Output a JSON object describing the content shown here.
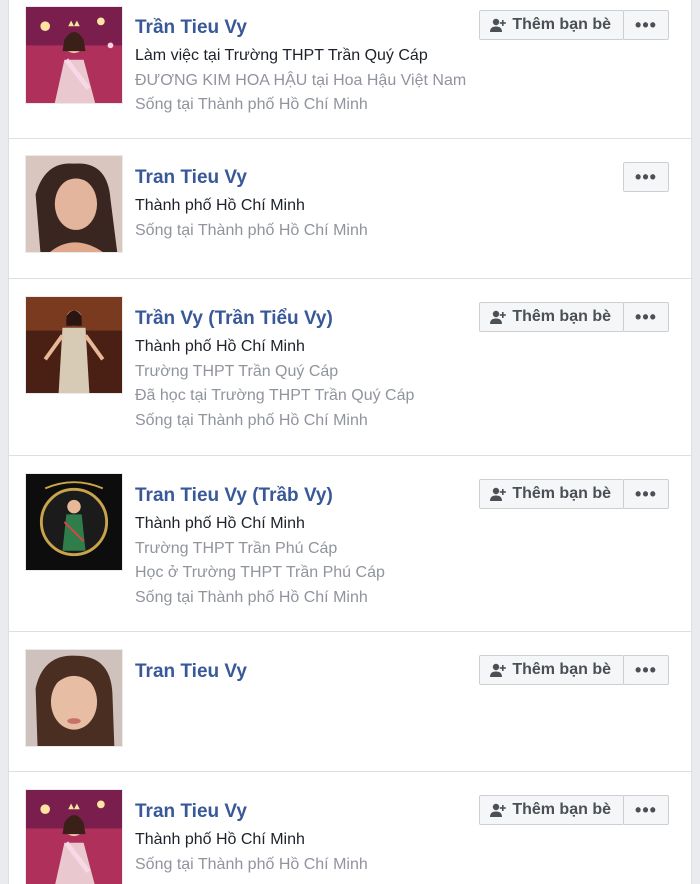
{
  "add_friend_label": "Thêm bạn bè",
  "more_label": "•••",
  "results": [
    {
      "name": "Trần Tieu Vy",
      "lines": [
        {
          "text": "Làm việc tại Trường THPT Trần Quý Cáp",
          "style": "dark"
        },
        {
          "text": "ĐƯƠNG KIM HOA HẬU tại Hoa Hậu Việt Nam",
          "style": "muted"
        },
        {
          "text": "Sống tại Thành phố Hồ Chí Minh",
          "style": "muted"
        }
      ],
      "has_add_friend": true
    },
    {
      "name": "Tran Tieu Vy",
      "lines": [
        {
          "text": "Thành phố Hồ Chí Minh",
          "style": "dark"
        },
        {
          "text": "Sống tại Thành phố Hồ Chí Minh",
          "style": "muted"
        }
      ],
      "has_add_friend": false
    },
    {
      "name": "Trần Vy (Trần Tiểu Vy)",
      "lines": [
        {
          "text": "Thành phố Hồ Chí Minh",
          "style": "dark"
        },
        {
          "text": "Trường THPT Trần Quý Cáp",
          "style": "muted"
        },
        {
          "text": "Đã học tại Trường THPT Trần Quý Cáp",
          "style": "muted"
        },
        {
          "text": "Sống tại Thành phố Hồ Chí Minh",
          "style": "muted"
        }
      ],
      "has_add_friend": true
    },
    {
      "name": "Tran Tieu Vy (Trầb Vy)",
      "lines": [
        {
          "text": "Thành phố Hồ Chí Minh",
          "style": "dark"
        },
        {
          "text": "Trường THPT Trần Phú Cáp",
          "style": "muted"
        },
        {
          "text": "Học ở Trường THPT Trần Phú Cáp",
          "style": "muted"
        },
        {
          "text": "Sống tại Thành phố Hồ Chí Minh",
          "style": "muted"
        }
      ],
      "has_add_friend": true
    },
    {
      "name": "Tran Tieu Vy",
      "lines": [],
      "has_add_friend": true
    },
    {
      "name": "Tran Tieu Vy",
      "lines": [
        {
          "text": "Thành phố Hồ Chí Minh",
          "style": "dark"
        },
        {
          "text": "Sống tại Thành phố Hồ Chí Minh",
          "style": "muted"
        }
      ],
      "has_add_friend": true
    }
  ]
}
